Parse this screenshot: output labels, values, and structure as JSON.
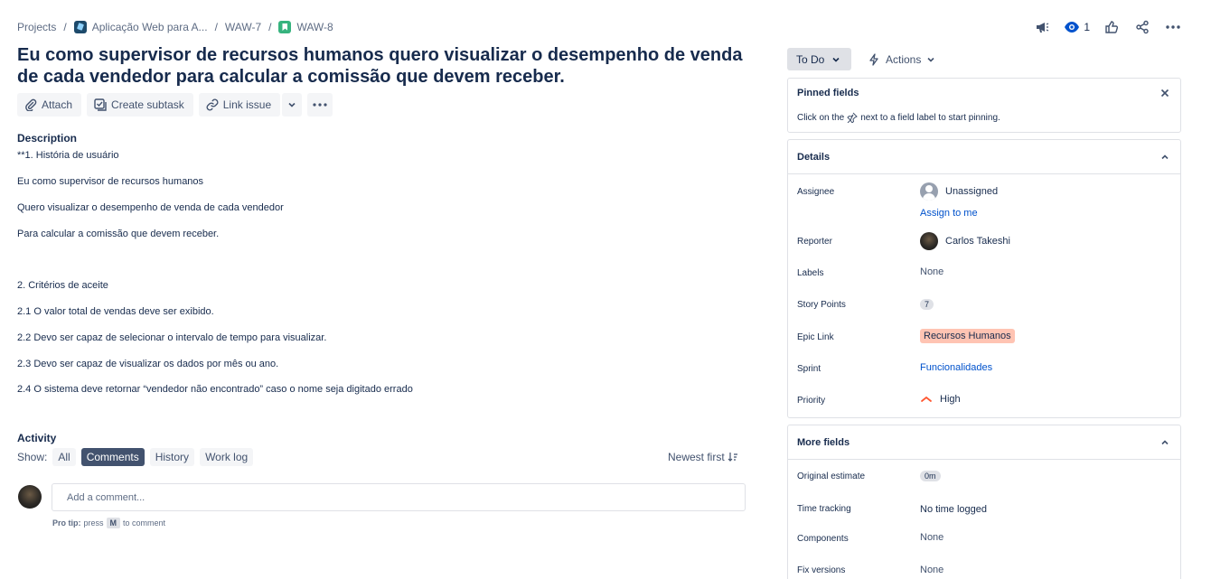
{
  "breadcrumb": {
    "projects": "Projects",
    "project": "Aplicação Web para A...",
    "parent": "WAW-7",
    "issue": "WAW-8"
  },
  "header": {
    "watchers": "1"
  },
  "issue": {
    "title": "Eu como supervisor de recursos humanos quero visualizar o desempenho de venda de cada vendedor para calcular a comissão que devem receber."
  },
  "toolbar": {
    "attach": "Attach",
    "create_subtask": "Create subtask",
    "link_issue": "Link issue"
  },
  "description": {
    "label": "Description",
    "lines": [
      "**1. História de usuário",
      "Eu como supervisor de recursos humanos",
      "Quero visualizar o desempenho de venda de cada vendedor",
      "Para calcular a comissão que devem receber.",
      "2. Critérios de aceite",
      "2.1 O valor total de vendas deve ser exibido.",
      "2.2 Devo ser capaz de selecionar o intervalo de tempo para visualizar.",
      "2.3 Devo ser capaz de visualizar os dados por mês ou ano.",
      "2.4 O sistema deve retornar “vendedor não encontrado” caso o nome seja digitado errado"
    ]
  },
  "activity": {
    "label": "Activity",
    "show": "Show:",
    "filters": [
      "All",
      "Comments",
      "History",
      "Work log"
    ],
    "active_filter": "Comments",
    "sort": "Newest first",
    "comment_placeholder": "Add a comment...",
    "protip_label": "Pro tip:",
    "protip_press": "press",
    "protip_key": "M",
    "protip_suffix": "to comment"
  },
  "status": {
    "label": "To Do",
    "actions": "Actions"
  },
  "pinned": {
    "title": "Pinned fields",
    "text_before": "Click on the",
    "text_after": "next to a field label to start pinning."
  },
  "details": {
    "title": "Details",
    "assignee_label": "Assignee",
    "assignee_value": "Unassigned",
    "assign_to_me": "Assign to me",
    "reporter_label": "Reporter",
    "reporter_value": "Carlos Takeshi",
    "labels_label": "Labels",
    "labels_value": "None",
    "story_points_label": "Story Points",
    "story_points_value": "7",
    "epic_label": "Epic Link",
    "epic_value": "Recursos Humanos",
    "sprint_label": "Sprint",
    "sprint_value": "Funcionalidades",
    "priority_label": "Priority",
    "priority_value": "High"
  },
  "more_fields": {
    "title": "More fields",
    "original_estimate_label": "Original estimate",
    "original_estimate_value": "0m",
    "time_tracking_label": "Time tracking",
    "time_tracking_value": "No time logged",
    "components_label": "Components",
    "components_value": "None",
    "fix_versions_label": "Fix versions",
    "fix_versions_value": "None"
  },
  "colors": {
    "link": "#0052cc",
    "epic_bg": "#ffc4b3",
    "priority_high": "#ff5630",
    "active_filter_bg": "#42526e"
  }
}
